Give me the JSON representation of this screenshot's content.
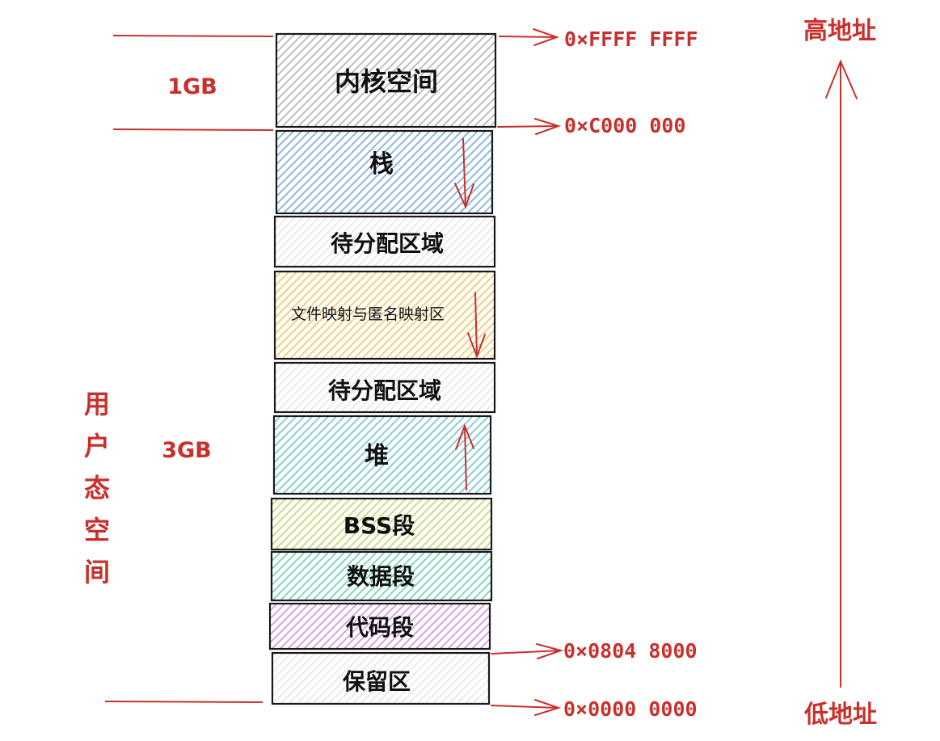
{
  "colors": {
    "accent_red": "#c9302c",
    "outline": "#1a1a1a",
    "kernel": "#9a9a9a",
    "stack": "#4a90d9",
    "unallocated": "#c4c4c4",
    "mmap": "#f2b230",
    "heap": "#3fb3c4",
    "bss": "#a6cc3c",
    "data": "#35c29a",
    "code": "#c86ad8",
    "reserved": "#c4c4c4"
  },
  "segments": [
    {
      "label": "内核空间"
    },
    {
      "label": "栈"
    },
    {
      "label": "待分配区域"
    },
    {
      "label": "文件映射与匿名映射区"
    },
    {
      "label": "待分配区域"
    },
    {
      "label": "堆"
    },
    {
      "label": "BSS段"
    },
    {
      "label": "数据段"
    },
    {
      "label": "代码段"
    },
    {
      "label": "保留区"
    }
  ],
  "addresses": {
    "top": "0×FFFF FFFF",
    "kernel_boundary": "0×C000 000",
    "code_start": "0×0804 8000",
    "bottom": "0×0000 0000"
  },
  "sizes": {
    "kernel": "1GB",
    "user": "3GB"
  },
  "user_space_label": "用户态空间",
  "high_address": "高地址",
  "low_address": "低地址"
}
